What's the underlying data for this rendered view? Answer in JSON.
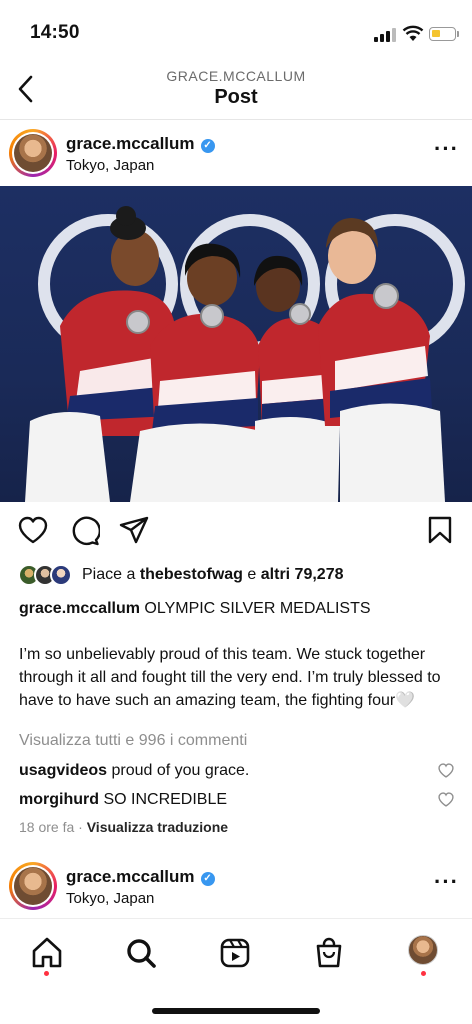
{
  "status": {
    "time": "14:50"
  },
  "header": {
    "subtitle": "GRACE.MCCALLUM",
    "title": "Post"
  },
  "post": {
    "username": "grace.mccallum",
    "location": "Tokyo, Japan",
    "likes": {
      "prefix": "Piace a",
      "liker": "thebestofwag",
      "connector": "e",
      "others": "altri 79,278"
    },
    "caption_headline": "OLYMPIC SILVER MEDALISTS",
    "caption_body": "I’m so unbelievably proud of this team. We stuck together through it all and fought till the very end. I’m truly blessed to have to have such an amazing team, the fighting four🤍",
    "view_comments": "Visualizza tutti e 996 i commenti",
    "comments": [
      {
        "user": "usagvideos",
        "text": "proud of you grace."
      },
      {
        "user": "morgihurd",
        "text": "SO INCREDIBLE"
      }
    ],
    "time_ago": "18 ore fa",
    "separator": "·",
    "translate": "Visualizza traduzione"
  },
  "next_post": {
    "username": "grace.mccallum",
    "location": "Tokyo, Japan"
  },
  "icons": {
    "back": "chevron-left-icon",
    "more": "more-horizontal-icon",
    "like": "heart-icon",
    "comment": "comment-bubble-icon",
    "share": "paper-plane-icon",
    "save": "bookmark-icon",
    "home": "home-icon",
    "search": "search-icon",
    "reels": "reels-icon",
    "shop": "shop-bag-icon"
  },
  "colors": {
    "verified": "#3897f0",
    "notification_dot": "#ff3040",
    "battery": "#f4c430",
    "muted_text": "#8e8e8e"
  }
}
